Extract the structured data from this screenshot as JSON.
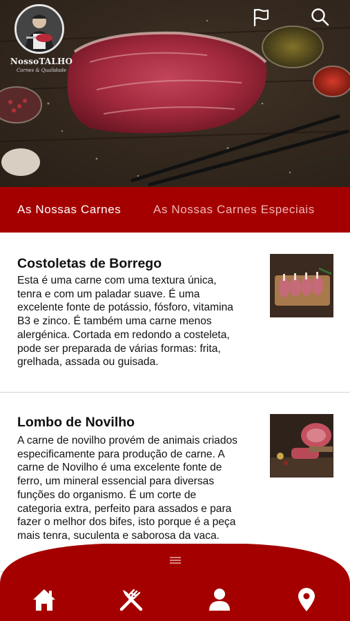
{
  "brand": {
    "name": "NossoTALHO",
    "tagline": "Carnes & Qualidade"
  },
  "header": {
    "icons": [
      "flag-icon",
      "search-icon"
    ]
  },
  "tabs": [
    {
      "label": "As Nossas Carnes",
      "active": true
    },
    {
      "label": "As Nossas Carnes Especiais",
      "active": false
    }
  ],
  "products": [
    {
      "title": "Costoletas de Borrego",
      "lines": [
        "Esta é uma carne com uma textura única,",
        "tenra e com um paladar suave. É uma",
        "excelente fonte de potássio, fósforo, vitamina",
        "B3 e zinco. É também uma carne menos",
        "alergénica. Cortada em redondo a costeleta,",
        "pode ser preparada de várias formas: frita,",
        "grelhada, assada ou guisada."
      ]
    },
    {
      "title": "Lombo de Novilho",
      "lines": [
        "A carne de novilho provém de animais criados",
        "especificamente para produção de carne. A",
        "carne de Novilho é uma excelente fonte de",
        "ferro, um mineral essencial para diversas",
        "funções do organismo. É um corte de",
        "categoria extra, perfeito para assados e para",
        "fazer o melhor dos bifes, isto porque é a peça",
        "mais tenra, suculenta e saborosa da vaca."
      ]
    }
  ],
  "bottom_nav": {
    "items": [
      "home-icon",
      "cutlery-icon",
      "user-icon",
      "location-icon"
    ],
    "handle_icon": "menu-handle-icon"
  },
  "colors": {
    "brand_red": "#a50000",
    "tab_inactive": "#f0b7b7",
    "text": "#111111"
  }
}
